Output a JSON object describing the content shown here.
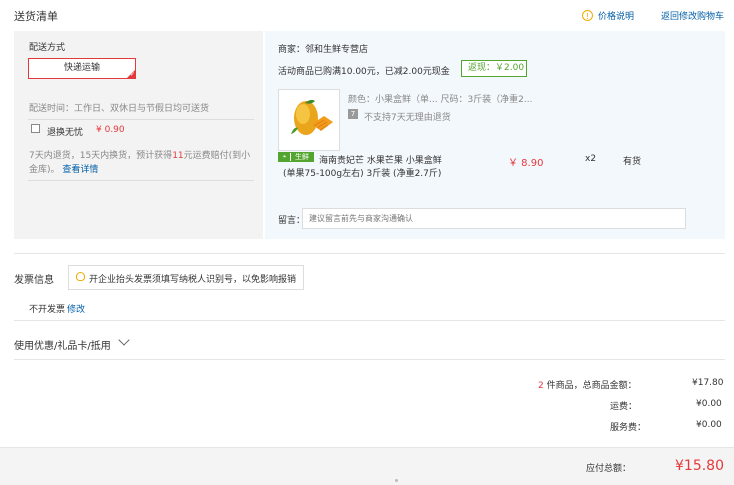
{
  "header": {
    "title": "送货清单",
    "price_help": "价格说明",
    "back_to_cart": "返回修改购物车"
  },
  "delivery": {
    "label": "配送方式",
    "option": "快递运输",
    "time": "配送时间：工作日、双休日与节假日均可送货",
    "return_worry_free": "退换无忧",
    "return_price": "¥ 0.90",
    "return_desc_line1_a": "7天内退货，15天内换货，预计获得",
    "return_desc_line1_num": "11",
    "return_desc_line1_b": "元运费赔付(到小",
    "return_desc_line2": "金库)。",
    "view_details": "查看详情"
  },
  "order": {
    "merchant": "商家：邻和生鲜专营店",
    "activity": "活动商品已购满10.00元，已减2.00元现金",
    "rebate": "返现：￥2.00",
    "item": {
      "attributes": "颜色：小果盒鲜（单... 尺码：3斤装（净重2...",
      "no_return": "不支持7天无理由退货",
      "fresh_badge": "生鲜",
      "name_line1": "海南贵妃芒 水果芒果 小果盒鲜",
      "name_line2": "(单果75-100g左右) 3斤装 (净重2.7斤)",
      "price": "￥ 8.90",
      "qty": "x2",
      "stock": "有货"
    },
    "remark_label": "留言：",
    "remark_placeholder": "建议留言前先与商家沟通确认"
  },
  "invoice": {
    "title": "发票信息",
    "tip": "开企业抬头发票须填写纳税人识别号，以免影响报销",
    "value": "不开发票",
    "edit": "修改"
  },
  "coupon": {
    "title": "使用优惠/礼品卡/抵用"
  },
  "summary": {
    "count": "2",
    "count_label": " 件商品，总商品金额：",
    "total": "¥17.80",
    "shipping_label": "运费：",
    "shipping": "¥0.00",
    "service_label": "服务费：",
    "service": "¥0.00"
  },
  "footer": {
    "pay_label": "应付总额：",
    "pay_amount": "¥15.80"
  },
  "colors": {
    "accent_red": "#e4393c",
    "link_blue": "#005ea7",
    "fresh_green": "#52a52e"
  }
}
